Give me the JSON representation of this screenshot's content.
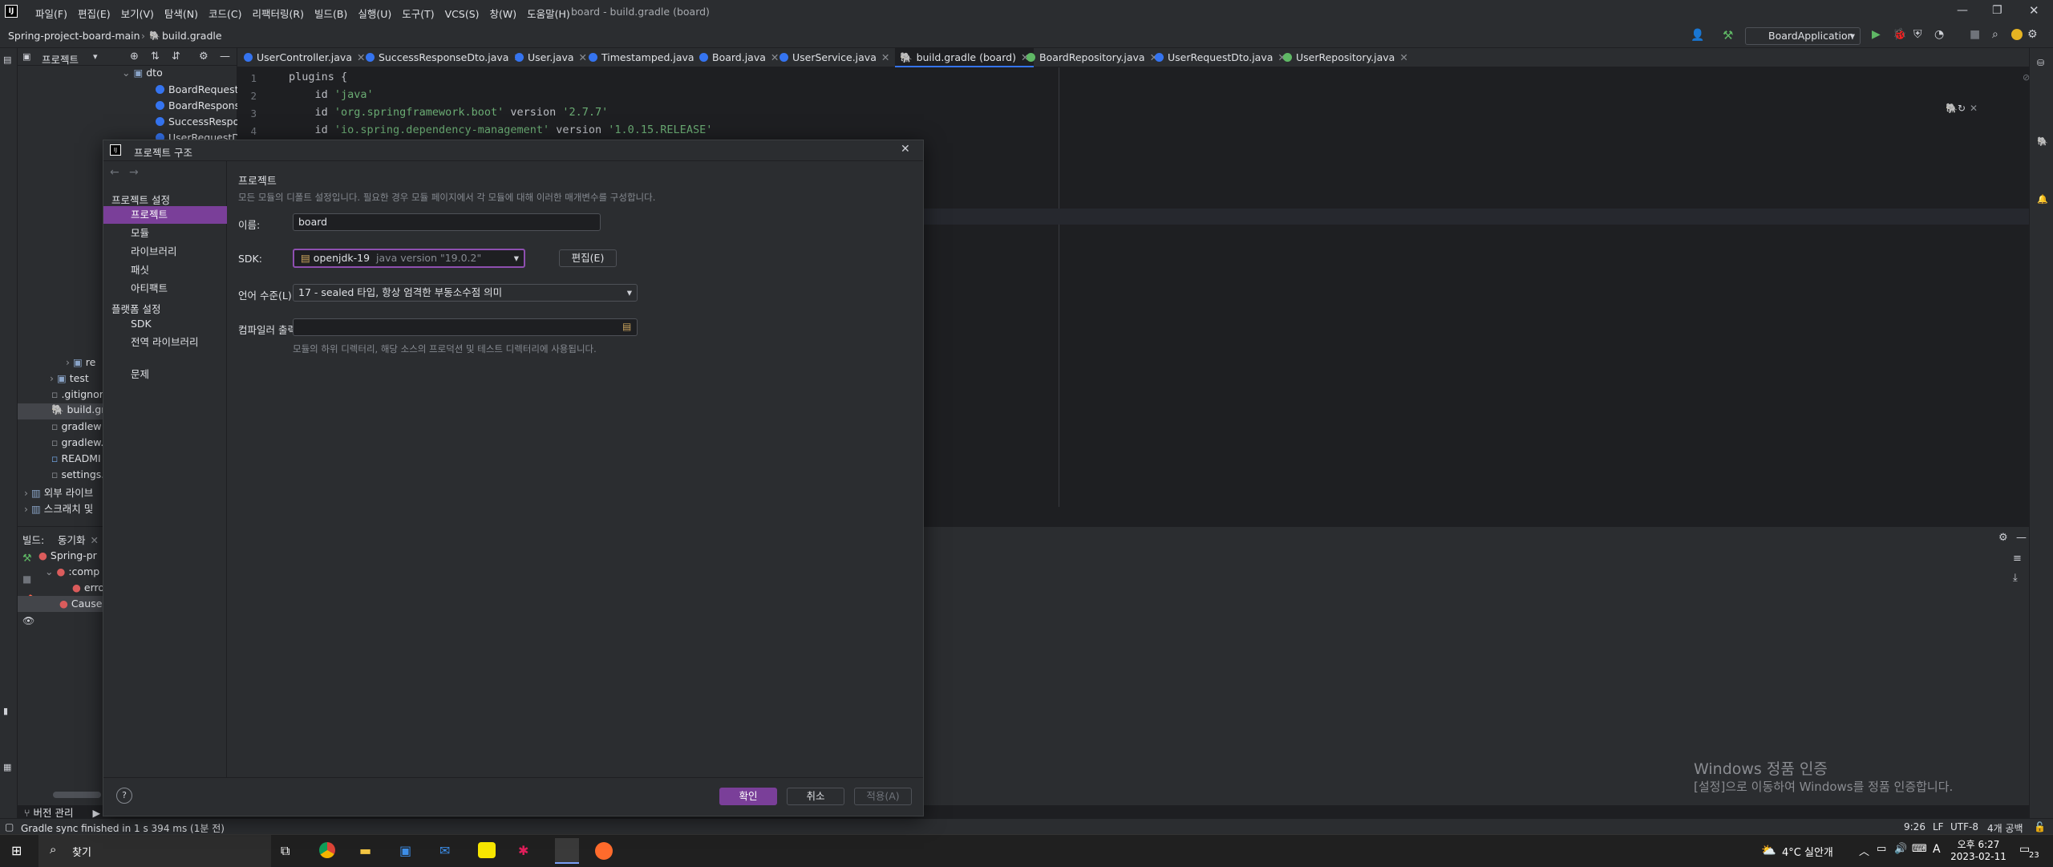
{
  "title_bar": {
    "menus": [
      "파일(F)",
      "편집(E)",
      "보기(V)",
      "탐색(N)",
      "코드(C)",
      "리팩터링(R)",
      "빌드(B)",
      "실행(U)",
      "도구(T)",
      "VCS(S)",
      "창(W)",
      "도움말(H)"
    ],
    "window_title": "board - build.gradle (board)"
  },
  "nav_bar": {
    "project": "Spring-project-board-main",
    "file": "build.gradle",
    "run_config": "BoardApplication"
  },
  "project_panel": {
    "header": "프로젝트",
    "tree": [
      {
        "label": "dto",
        "type": "folder"
      },
      {
        "label": "BoardRequestsD",
        "type": "class"
      },
      {
        "label": "BoardResponseD",
        "type": "class"
      },
      {
        "label": "SuccessRespons",
        "type": "class"
      },
      {
        "label": "UserRequestDto",
        "type": "class"
      },
      {
        "label": "re",
        "type": "folder"
      },
      {
        "label": "test",
        "type": "folder"
      },
      {
        "label": ".gitignor",
        "type": "file"
      },
      {
        "label": "build.gra",
        "type": "file"
      },
      {
        "label": "gradlew",
        "type": "file"
      },
      {
        "label": "gradlew.",
        "type": "file"
      },
      {
        "label": "READMI",
        "type": "file"
      },
      {
        "label": "settings.",
        "type": "file"
      },
      {
        "label": "외부 라이브",
        "type": "folder"
      },
      {
        "label": "스크래치 및",
        "type": "folder"
      }
    ]
  },
  "tabs": [
    {
      "label": "UserController.java",
      "icon": "class"
    },
    {
      "label": "SuccessResponseDto.java",
      "icon": "class"
    },
    {
      "label": "User.java",
      "icon": "class"
    },
    {
      "label": "Timestamped.java",
      "icon": "class"
    },
    {
      "label": "Board.java",
      "icon": "class"
    },
    {
      "label": "UserService.java",
      "icon": "class"
    },
    {
      "label": "build.gradle (board)",
      "icon": "gradle",
      "active": true
    },
    {
      "label": "BoardRepository.java",
      "icon": "interface"
    },
    {
      "label": "UserRequestDto.java",
      "icon": "class"
    },
    {
      "label": "UserRepository.java",
      "icon": "interface"
    }
  ],
  "editor": {
    "lines": [
      {
        "num": "1",
        "text": "plugins {"
      },
      {
        "num": "2",
        "kw": "    id ",
        "str": "'java'"
      },
      {
        "num": "3",
        "kw": "    id ",
        "str": "'org.springframework.boot'",
        "rest": " version ",
        "str2": "'2.7.7'"
      },
      {
        "num": "4",
        "kw": "    id ",
        "str": "'io.spring.dependency-management'",
        "rest": " version ",
        "str2": "'1.0.15.RELEASE'"
      }
    ]
  },
  "build_panel": {
    "tabs": [
      "빌드:",
      "동기화"
    ],
    "tree": [
      {
        "label": "Spring-pr",
        "status": "error"
      },
      {
        "label": ":comp",
        "status": "error"
      },
      {
        "label": "erro",
        "status": "error"
      },
      {
        "label": "Cause:",
        "status": "error"
      }
    ]
  },
  "dialog": {
    "title": "프로젝트 구조",
    "nav": {
      "project_settings_header": "프로젝트 설정",
      "items_project": [
        "프로젝트",
        "모듈",
        "라이브러리",
        "패싯",
        "아티팩트"
      ],
      "platform_header": "플랫폼 설정",
      "items_platform": [
        "SDK",
        "전역 라이브러리"
      ],
      "problems": "문제"
    },
    "main": {
      "heading": "프로젝트",
      "description": "모든 모듈의 디폴트 설정입니다. 필요한 경우 모듈 페이지에서 각 모듈에 대해 이러한 매개변수를 구성합니다.",
      "name_label": "이름:",
      "name_value": "board",
      "sdk_label": "SDK:",
      "sdk_value": "openjdk-19",
      "sdk_version": "java version \"19.0.2\"",
      "sdk_edit": "편집(E)",
      "lang_label": "언어 수준(L):",
      "lang_value": "17 - sealed 타입, 항상 엄격한 부동소수점 의미",
      "compiler_label": "컴파일러 출력:",
      "compiler_value": "",
      "compiler_hint": "모듈의 하위 디렉터리, 해당 소스의 프로덕션 및 테스트 디렉터리에 사용됩니다."
    },
    "footer": {
      "ok": "확인",
      "cancel": "취소",
      "apply": "적용(A)"
    }
  },
  "status_bar": {
    "vcs": "버전 관리",
    "message": "Gradle sync finished in 1 s 394 ms (1분 전)",
    "position": "9:26",
    "line_sep": "LF",
    "encoding": "UTF-8",
    "indent": "4개 공백"
  },
  "watermark": {
    "line1": "Windows 정품 인증",
    "line2": "[설정]으로 이동하여 Windows를 정품 인증합니다."
  },
  "taskbar": {
    "search": "찾기",
    "weather": "4°C 실안개",
    "time": "오후 6:27",
    "date": "2023-02-11",
    "ime": "A",
    "notif": "23"
  }
}
